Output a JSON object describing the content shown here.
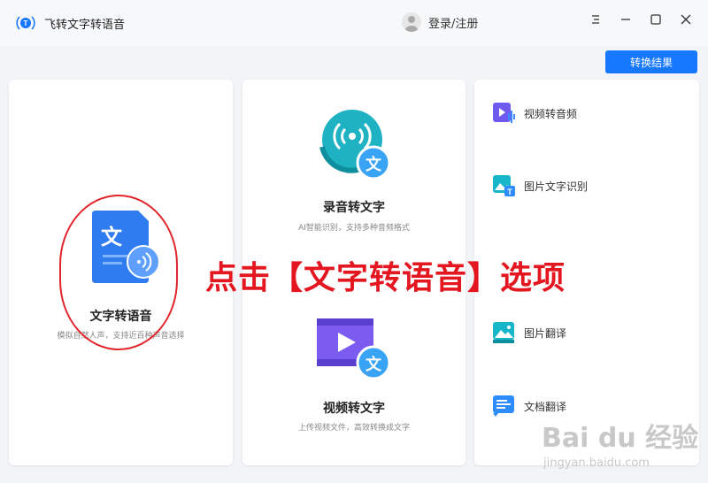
{
  "app": {
    "title": "飞转文字转语音"
  },
  "header": {
    "login_label": "登录/注册",
    "convert_button": "转换结果"
  },
  "cards": {
    "text_to_speech": {
      "title": "文字转语音",
      "subtitle": "模拟自然人声，支持近百种声音选择",
      "icon_char": "文"
    },
    "record_to_text": {
      "title": "录音转文字",
      "subtitle": "AI智能识别，支持多种音频格式",
      "icon_char": "文"
    },
    "video_to_text": {
      "title": "视频转文字",
      "subtitle": "上传视频文件，高效转换成文字",
      "icon_char": "文"
    }
  },
  "tools": [
    {
      "label": "视频转音频"
    },
    {
      "label": "图片文字识别"
    },
    {
      "label": "图片翻译"
    },
    {
      "label": "文档翻译"
    }
  ],
  "annotation": "点击【文字转语音】选项",
  "watermark": {
    "main": "Bai du 经验",
    "url": "jingyan.baidu.com"
  },
  "colors": {
    "accent": "#1677ff",
    "annotation": "#e4161f"
  }
}
